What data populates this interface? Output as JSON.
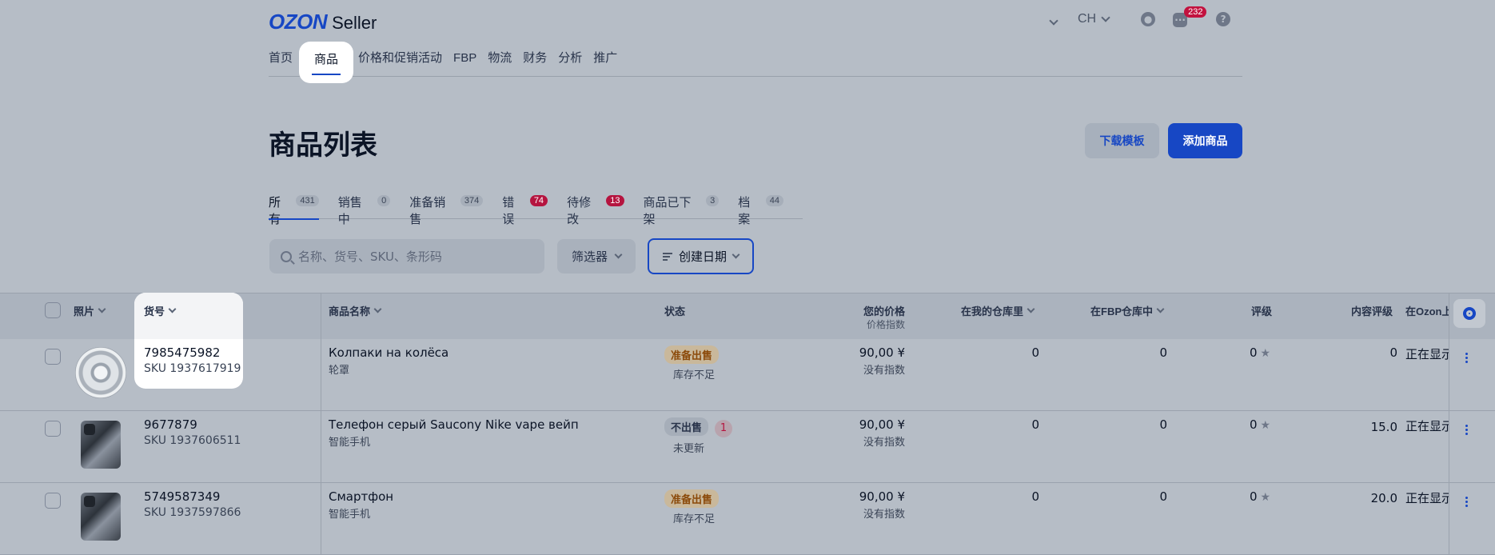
{
  "header": {
    "logo_brand": "OZON",
    "logo_product": "Seller",
    "lang": "CH",
    "message_count": "232"
  },
  "nav": {
    "items": [
      "首页",
      "商品",
      "价格和促销活动",
      "FBP",
      "物流",
      "财务",
      "分析",
      "推广"
    ],
    "active": "商品"
  },
  "page": {
    "title": "商品列表",
    "download_template": "下载模板",
    "add_product": "添加商品"
  },
  "tabs": [
    {
      "label": "所有",
      "count": "431"
    },
    {
      "label": "销售中",
      "count": "0"
    },
    {
      "label": "准备销售",
      "count": "374"
    },
    {
      "label": "错误",
      "count": "74"
    },
    {
      "label": "待修改",
      "count": "13"
    },
    {
      "label": "商品已下架",
      "count": "3"
    },
    {
      "label": "档案",
      "count": "44"
    }
  ],
  "toolbar": {
    "search_placeholder": "名称、货号、SKU、条形码",
    "filter_label": "筛选器",
    "sort_label": "创建日期"
  },
  "table": {
    "headers": {
      "photo": "照片",
      "article": "货号",
      "name": "商品名称",
      "status": "状态",
      "price": "您的价格",
      "price_sub": "价格指数",
      "my_stock": "在我的仓库里",
      "fbp_stock": "在FBP仓库中",
      "rating": "评级",
      "content_rating": "内容评级",
      "on_ozon": "在Ozon上"
    },
    "rows": [
      {
        "article": "7985475982",
        "sku": "SKU 1937617919",
        "name": "Колпаки на колёса",
        "category": "轮罩",
        "status": "准备出售",
        "status_sub": "库存不足",
        "price": "90,00 ¥",
        "price_index": "没有指数",
        "my_stock": "0",
        "fbp_stock": "0",
        "rating": "0",
        "content_rating": "0",
        "on_ozon": "正在显示"
      },
      {
        "article": "9677879",
        "sku": "SKU 1937606511",
        "name": "Телефон серый Saucony Nike vape вейп",
        "category": "智能手机",
        "status": "不出售",
        "status_count": "1",
        "status_sub": "未更新",
        "price": "90,00 ¥",
        "price_index": "没有指数",
        "my_stock": "0",
        "fbp_stock": "0",
        "rating": "0",
        "content_rating": "15.0",
        "on_ozon": "正在显示"
      },
      {
        "article": "5749587349",
        "sku": "SKU 1937597866",
        "name": "Смартфон",
        "category": "智能手机",
        "status": "准备出售",
        "status_sub": "库存不足",
        "price": "90,00 ¥",
        "price_index": "没有指数",
        "my_stock": "0",
        "fbp_stock": "0",
        "rating": "0",
        "content_rating": "20.0",
        "on_ozon": "正在显示"
      }
    ]
  },
  "colors": {
    "accent": "#1747c4",
    "overlay_bg": "#b6bdc6",
    "error_red": "#b5143f",
    "warning_amber": "#8b4a0a"
  }
}
